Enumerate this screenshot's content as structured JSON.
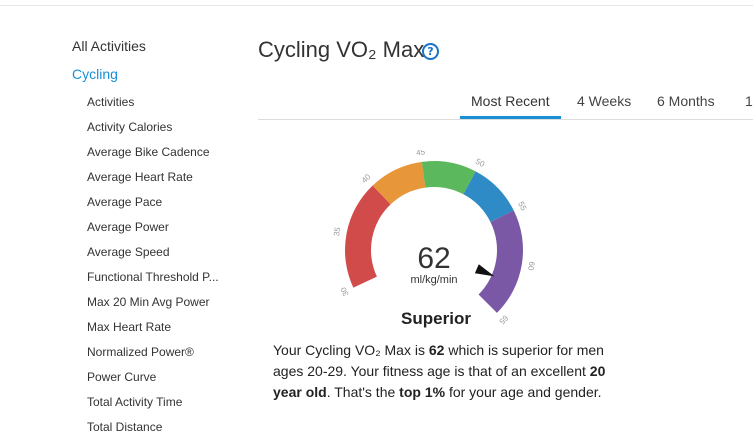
{
  "sidebar": {
    "all_activities": "All Activities",
    "category": "Cycling",
    "items": [
      {
        "label": "Activities"
      },
      {
        "label": "Activity Calories"
      },
      {
        "label": "Average Bike Cadence"
      },
      {
        "label": "Average Heart Rate"
      },
      {
        "label": "Average Pace"
      },
      {
        "label": "Average Power"
      },
      {
        "label": "Average Speed"
      },
      {
        "label": "Functional Threshold P..."
      },
      {
        "label": "Max 20 Min Avg Power"
      },
      {
        "label": "Max Heart Rate"
      },
      {
        "label": "Normalized Power®"
      },
      {
        "label": "Power Curve"
      },
      {
        "label": "Total Activity Time"
      },
      {
        "label": "Total Distance"
      }
    ]
  },
  "header": {
    "title": "Cycling VO₂ Max",
    "help_icon": "question-circle-icon"
  },
  "tabs": [
    {
      "label": "Most Recent",
      "active": true
    },
    {
      "label": "4 Weeks"
    },
    {
      "label": "6 Months"
    },
    {
      "label": "1"
    }
  ],
  "gauge": {
    "value": "62",
    "unit": "ml/kg/min",
    "rating": "Superior",
    "ticks": [
      "30",
      "35",
      "40",
      "45",
      "50",
      "55",
      "60",
      "65"
    ],
    "segments": [
      {
        "from": 30,
        "to": 40,
        "color": "#d14b4b"
      },
      {
        "from": 40,
        "to": 45,
        "color": "#e8963a"
      },
      {
        "from": 45,
        "to": 50,
        "color": "#5cb85c"
      },
      {
        "from": 50,
        "to": 55,
        "color": "#2e8bc6"
      },
      {
        "from": 55,
        "to": 65,
        "color": "#7a58a6"
      }
    ],
    "scale_min": 30,
    "scale_max": 65,
    "pointer_value": 62
  },
  "summary": {
    "p1": "Your Cycling VO₂ Max is ",
    "value": "62",
    "p2": " which is superior for men ages 20-29. Your fitness age is that of an excellent ",
    "age": "20 year old",
    "p3": ". That's the ",
    "top": "top 1%",
    "p4": " for your age and gender."
  },
  "colors": {
    "accent": "#1a8fd6"
  }
}
